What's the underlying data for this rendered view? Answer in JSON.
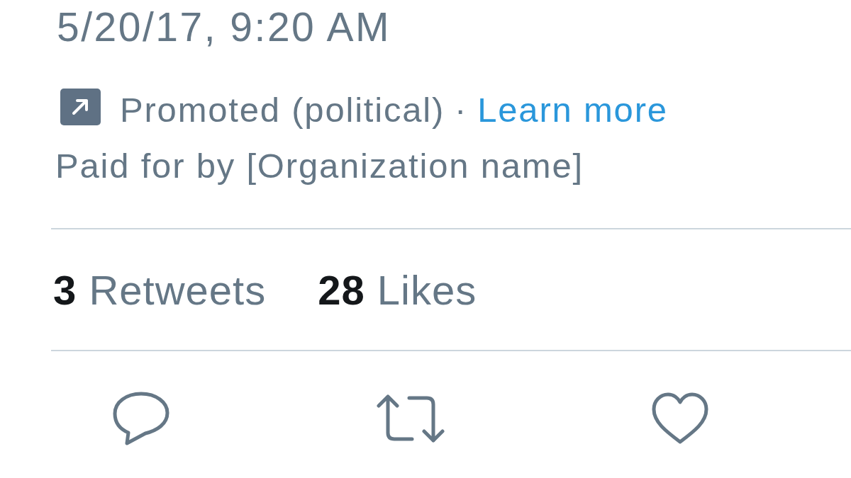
{
  "timestamp": "5/20/17, 9:20 AM",
  "promotion": {
    "label": "Promoted (political)",
    "separator": "·",
    "link": "Learn more"
  },
  "disclosure": "Paid for by [Organization name]",
  "stats": [
    {
      "count": "3",
      "label": "Retweets"
    },
    {
      "count": "28",
      "label": "Likes"
    }
  ],
  "actions": [
    {
      "kind": "reply"
    },
    {
      "kind": "retweet"
    },
    {
      "kind": "like"
    }
  ]
}
